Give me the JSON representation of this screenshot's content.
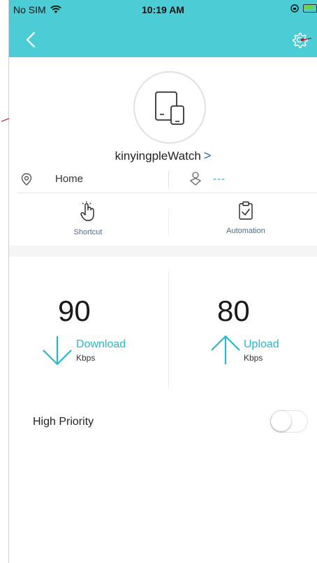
{
  "status_bar": {
    "carrier": "No SIM",
    "time": "10:19 AM"
  },
  "device": {
    "name": "kinyingpleWatch",
    "chevron": ">"
  },
  "info": {
    "location_label": "Home",
    "person_value": "---"
  },
  "actions": {
    "shortcut_label": "Shortcut",
    "automation_label": "Automation"
  },
  "speeds": {
    "download": {
      "value": "90",
      "label": "Download",
      "unit": "Kbps"
    },
    "upload": {
      "value": "80",
      "label": "Upload",
      "unit": "Kbps"
    }
  },
  "priority": {
    "label": "High Priority",
    "enabled": false
  },
  "colors": {
    "header": "#4ccdd6",
    "accent": "#2ab7cd",
    "annotation": "#c0102a"
  },
  "icons": {
    "back": "chevron-left-icon",
    "settings": "gear-icon",
    "device": "tablet-phone-icon",
    "location": "location-pin-icon",
    "person": "person-icon",
    "shortcut": "hand-tap-icon",
    "automation": "clipboard-check-icon",
    "download": "arrow-down-icon",
    "upload": "arrow-up-icon"
  }
}
